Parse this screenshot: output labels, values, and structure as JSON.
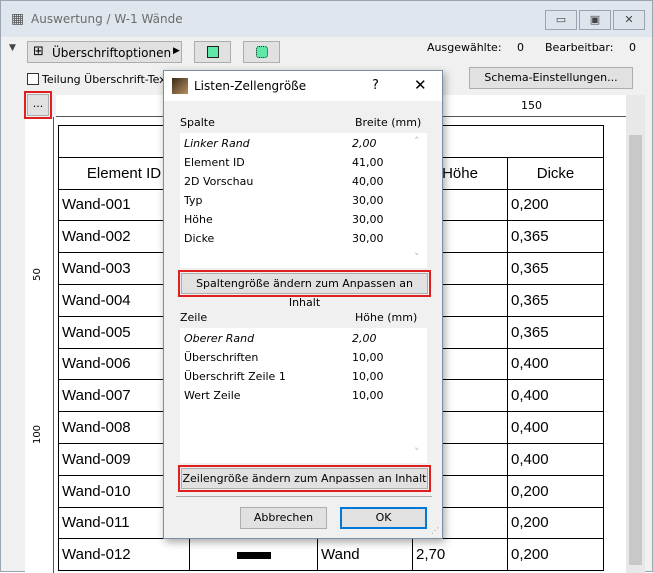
{
  "window": {
    "title": "Auswertung / W-1 Wände",
    "minimize": "▭",
    "maximize": "▣",
    "close": "✕"
  },
  "toolbar": {
    "heading_options": "Überschriftoptionen",
    "selected_label": "Ausgewählte:",
    "selected_value": "0",
    "editable_label": "Bearbeitbar:",
    "editable_value": "0",
    "split_heading": "Teilung Überschrift-Text",
    "schema_settings": "Schema-Einstellungen...",
    "more": "..."
  },
  "ruler": {
    "label_150": "150",
    "label_50": "50",
    "label_100": "100"
  },
  "table": {
    "headers": [
      "Element ID",
      "",
      "",
      "Höhe",
      "Dicke"
    ],
    "rows": [
      [
        "Wand-001",
        "0,200"
      ],
      [
        "Wand-002",
        "0,365"
      ],
      [
        "Wand-003",
        "0,365"
      ],
      [
        "Wand-004",
        "0,365"
      ],
      [
        "Wand-005",
        "0,365"
      ],
      [
        "Wand-006",
        "0,400"
      ],
      [
        "Wand-007",
        "0,400"
      ],
      [
        "Wand-008",
        "0,400"
      ],
      [
        "Wand-009",
        "0,400"
      ],
      [
        "Wand-010",
        "0,200"
      ],
      [
        "Wand-011",
        "0,200"
      ],
      [
        "Wand-012",
        "0,200"
      ]
    ],
    "last_row": {
      "typ": "Wand",
      "hoehe": "2,70"
    }
  },
  "dialog": {
    "title": "Listen-Zellengröße",
    "help": "?",
    "close": "✕",
    "columns_header": "Spalte",
    "width_header": "Breite  (mm)",
    "columns": [
      {
        "name": "Linker Rand",
        "value": "2,00"
      },
      {
        "name": "Element ID",
        "value": "41,00"
      },
      {
        "name": "2D Vorschau",
        "value": "40,00"
      },
      {
        "name": "Typ",
        "value": "30,00"
      },
      {
        "name": "Höhe",
        "value": "30,00"
      },
      {
        "name": "Dicke",
        "value": "30,00"
      }
    ],
    "fit_columns": "Spaltengröße ändern zum Anpassen an Inhalt",
    "rows_header": "Zeile",
    "height_header": "Höhe  (mm)",
    "rows": [
      {
        "name": "Oberer Rand",
        "value": "2,00"
      },
      {
        "name": "Überschriften",
        "value": "10,00"
      },
      {
        "name": "Überschrift Zeile 1",
        "value": "10,00"
      },
      {
        "name": "Wert Zeile",
        "value": "10,00"
      }
    ],
    "fit_rows": "Zeilengröße ändern zum Anpassen an Inhalt",
    "cancel": "Abbrechen",
    "ok": "OK"
  }
}
